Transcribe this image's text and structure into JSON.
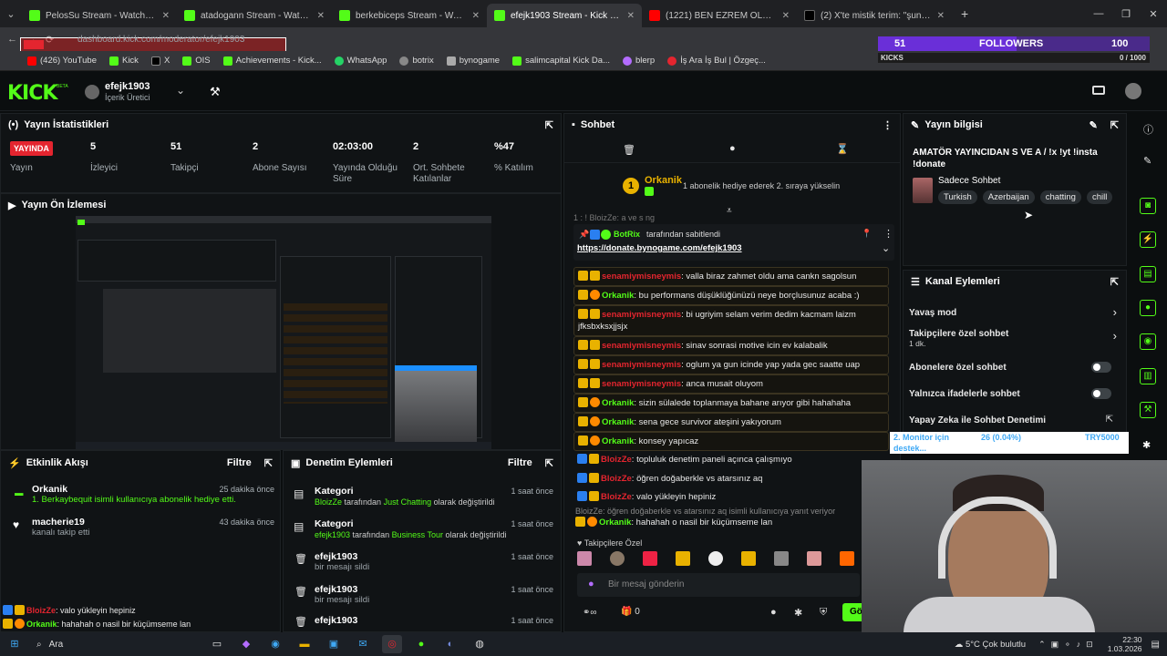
{
  "browser": {
    "tabs": [
      {
        "title": "PelosSu Stream - Watch Live o",
        "icon": "kick"
      },
      {
        "title": "atadogann Stream - Watch Live",
        "icon": "kick"
      },
      {
        "title": "berkebiceps Stream - Watch Li",
        "icon": "kick"
      },
      {
        "title": "efejk1903 Stream - Kick Dashb",
        "icon": "kick",
        "active": true
      },
      {
        "title": "(1221) BEN EZREM OLDUYSAM",
        "icon": "youtube"
      },
      {
        "title": "(2) X'te mistik terim: \"şuna faul",
        "icon": "x"
      }
    ],
    "url": "dashboard.kick.com/moderator/efejk1903",
    "bookmarks": [
      "(426) YouTube",
      "Kick",
      "X",
      "OIS",
      "Achievements - Kick...",
      "WhatsApp",
      "botrix",
      "bynogame",
      "salimcapital Kick Da...",
      "blerp",
      "İş Ara İş Bul | Özgeç..."
    ]
  },
  "overlay": {
    "followers_count": "51",
    "followers_label": "FOLLOWERS",
    "followers_goal": "100",
    "kicks_label": "KICKS",
    "kicks_progress": "0 / 1000"
  },
  "header": {
    "logo": "KICK",
    "logo_badge": "BETA",
    "username": "efejk1903",
    "role": "İçerik Üretici"
  },
  "stats": {
    "title": "Yayın İstatistikleri",
    "live_badge": "YAYINDA",
    "live_label": "Yayın",
    "items": [
      {
        "value": "5",
        "label": "İzleyici"
      },
      {
        "value": "51",
        "label": "Takipçi"
      },
      {
        "value": "2",
        "label": "Abone Sayısı"
      },
      {
        "value": "02:03:00",
        "label": "Yayında Olduğu Süre"
      },
      {
        "value": "2",
        "label": "Ort. Sohbete Katılanlar"
      },
      {
        "value": "%47",
        "label": "% Katılım"
      }
    ]
  },
  "preview": {
    "title": "Yayın Ön İzlemesi"
  },
  "activity": {
    "title": "Etkinlik Akışı",
    "filter": "Filtre",
    "items": [
      {
        "name": "Orkanik",
        "text": "1. Berkaybequit isimli kullanıcıya abonelik hediye etti.",
        "time": "25 dakika önce"
      },
      {
        "name": "macherie19",
        "text": "kanalı takip etti",
        "time": "43 dakika önce"
      }
    ]
  },
  "moderation": {
    "title": "Denetim Eylemleri",
    "filter": "Filtre",
    "items": [
      {
        "title": "Kategori",
        "user": "BloizZe",
        "mid": " tarafından ",
        "target": "Just Chatting",
        "end": " olarak değiştirildi",
        "time": "1 saat önce"
      },
      {
        "title": "Kategori",
        "user": "efejk1903",
        "mid": " tarafından ",
        "target": "Business Tour",
        "end": " olarak değiştirildi",
        "time": "1 saat önce"
      },
      {
        "title": "efejk1903",
        "text": "bir mesajı sildi",
        "time": "1 saat önce"
      },
      {
        "title": "efejk1903",
        "text": "bir mesajı sildi",
        "time": "1 saat önce"
      },
      {
        "title": "efejk1903",
        "text": "",
        "time": "1 saat önce"
      }
    ]
  },
  "mini_chat": [
    {
      "user": "BloizZe",
      "text": ": valo yükleyin hepiniz"
    },
    {
      "user": "Orkanik",
      "text": ": hahahah o nasil bir küçümseme lan"
    }
  ],
  "chat": {
    "title": "Sohbet",
    "sub_banner": {
      "user": "Orkanik",
      "count": "1",
      "text": "1 abonelik hediye ederek 2. sıraya yükselin"
    },
    "partial_line": "1 :  ! BloizZe: a ve s ng",
    "pinned": {
      "by": "BotRix",
      "by_text": "tarafından sabitlendi",
      "link": "https://donate.bynogame.com/efejk1903"
    },
    "messages": [
      {
        "user": "senamiymisneymis",
        "text": "valla biraz zahmet oldu ama cankn sagolsun",
        "own": false
      },
      {
        "user": "Orkanik",
        "text": "bu performans düşüklüğünüzü neye borçlusunuz acaba :)",
        "own": true
      },
      {
        "user": "senamiymisneymis",
        "text": "bi ugriyim selam verim dedim kacmam laizm jfksbxksxjjsjx",
        "own": false
      },
      {
        "user": "senamiymisneymis",
        "text": "sinav sonrasi motive icin ev kalabalik",
        "own": false
      },
      {
        "user": "senamiymisneymis",
        "text": "oglum ya gun icinde yap yada gec saatte uap",
        "own": false
      },
      {
        "user": "senamiymisneymis",
        "text": "anca musait oluyom",
        "own": false
      },
      {
        "user": "Orkanik",
        "text": "sizin sülalede toplanmaya bahane arıyor gibi hahahaha",
        "own": true
      },
      {
        "user": "Orkanik",
        "text": "sena gece survivor ateşini yakıyorum",
        "own": true
      },
      {
        "user": "Orkanik",
        "text": "konsey yapıcaz",
        "own": true
      },
      {
        "user": "BloizZe",
        "text": "topluluk denetim paneli açınca çalışmıyo",
        "own": false
      },
      {
        "user": "BloizZe",
        "text": "öğren doğaberkle vs atarsınız aq",
        "own": false
      },
      {
        "user": "BloizZe",
        "text": "valo yükleyin hepiniz",
        "own": false
      }
    ],
    "reply_context": "BloizZe: öğren doğaberkle vs atarsınız aq isimli kullanıcıya yanıt veriyor",
    "reply_line": {
      "user": "Orkanik",
      "text": "hahahah o nasil bir küçümseme lan"
    },
    "followers_only": "Takipçilere Özel",
    "input_placeholder": "Bir mesaj gönderin",
    "points": "0",
    "send_label": "Gö"
  },
  "stream_info": {
    "title": "Yayın bilgisi",
    "stream_title": "AMATÖR YAYINCIDAN S VE A / !x !yt !insta !donate",
    "category": "Sadece Sohbet",
    "tags": [
      "Turkish",
      "Azerbaijan",
      "chatting",
      "chill"
    ]
  },
  "channel_actions": {
    "title": "Kanal Eylemleri",
    "items": [
      {
        "label": "Yavaş mod",
        "sub": "",
        "type": "arrow"
      },
      {
        "label": "Takipçilere özel sohbet",
        "sub": "1 dk.",
        "type": "arrow"
      },
      {
        "label": "Abonelere özel sohbet",
        "sub": "",
        "type": "toggle"
      },
      {
        "label": "Yalnızca ifadelerle sohbet",
        "sub": "",
        "type": "toggle"
      },
      {
        "label": "Yapay Zeka ile Sohbet Denetimi",
        "sub": "",
        "type": "external"
      }
    ]
  },
  "monitor_overlay": {
    "line1": "2. Monitor için",
    "value": "26 (0.04%)",
    "amount": "TRY5000",
    "line2": "destek..."
  },
  "taskbar": {
    "search": "Ara",
    "weather": "5°C  Çok bulutlu",
    "time": "22:30",
    "date": "1.03.2026"
  },
  "colors": {
    "kick_green": "#53fc18",
    "live_red": "#e4252f",
    "gold": "#e9b200"
  }
}
